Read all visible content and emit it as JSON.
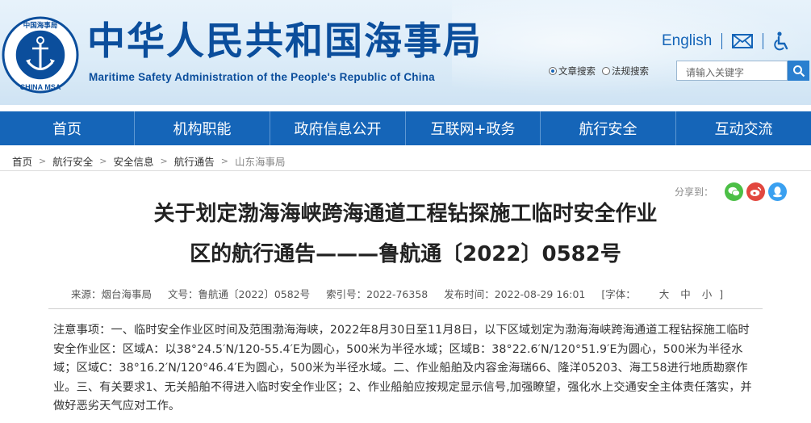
{
  "header": {
    "logo_text_top": "中国海事局",
    "logo_text_bottom": "CHINA MSA",
    "title_cn": "中华人民共和国海事局",
    "title_en": "Maritime Safety Administration of the People's Republic of China",
    "english_link": "English",
    "colors": {
      "brand_blue": "#0b4e9c",
      "nav_blue": "#1565b8"
    }
  },
  "search": {
    "option_article": "文章搜索",
    "option_law": "法规搜索",
    "placeholder": "请输入关键字"
  },
  "nav": {
    "items": [
      {
        "label": "首页"
      },
      {
        "label": "机构职能"
      },
      {
        "label": "政府信息公开"
      },
      {
        "label": "互联网+政务"
      },
      {
        "label": "航行安全"
      },
      {
        "label": "互动交流"
      }
    ]
  },
  "breadcrumb": {
    "items": [
      "首页",
      "航行安全",
      "安全信息",
      "航行通告",
      "山东海事局"
    ]
  },
  "share": {
    "label": "分享到：",
    "icons": [
      "wechat-icon",
      "weibo-icon",
      "qq-icon"
    ]
  },
  "article": {
    "title_line1": "关于划定渤海海峡跨海通道工程钻探施工临时安全作业",
    "title_line2": "区的航行通告———鲁航通〔2022〕0582号",
    "meta": {
      "source": "来源：烟台海事局",
      "doc_no": "文号：鲁航通〔2022〕0582号",
      "index_no": "索引号：2022-76358",
      "publish_time": "发布时间：2022-08-29 16:01",
      "font_label": "[字体：",
      "font_large": "大",
      "font_medium": "中",
      "font_small": "小",
      "font_close": "]"
    },
    "body": "注意事项：一、临时安全作业区时间及范围渤海海峡，2022年8月30日至11月8日，以下区域划定为渤海海峡跨海通道工程钻探施工临时安全作业区：区域A：以38°24.5′N/120-55.4′E为圆心，500米为半径水域；区域B：38°22.6′N/120°51.9′E为圆心，500米为半径水域；区域C：38°16.2′N/120°46.4′E为圆心，500米为半径水域。二、作业船舶及内容金海瑞66、隆洋05203、海工58进行地质勘察作业。三、有关要求1、无关船舶不得进入临时安全作业区；2、作业船舶应按规定显示信号,加强瞭望，强化水上交通安全主体责任落实，并做好恶劣天气应对工作。"
  }
}
